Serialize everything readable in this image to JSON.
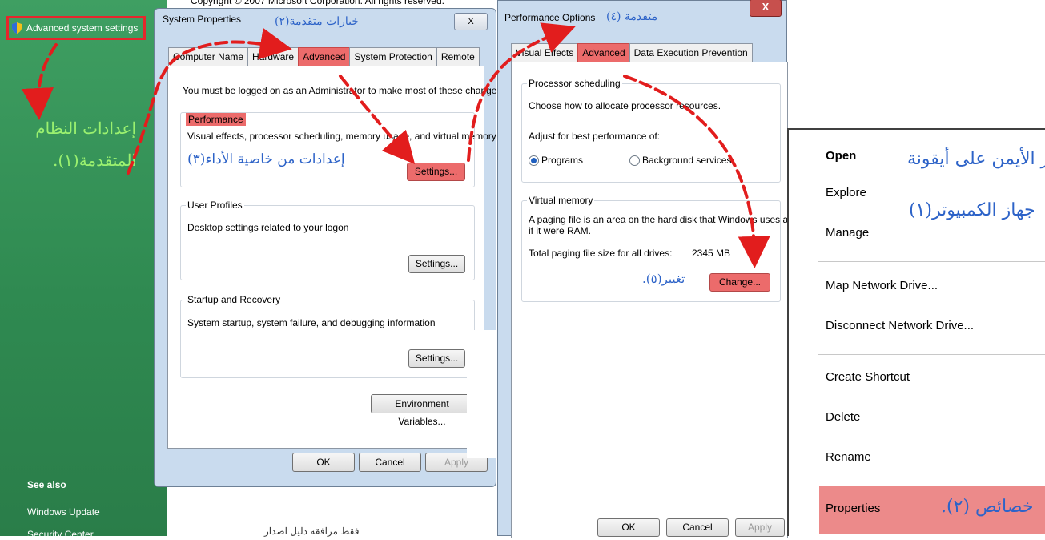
{
  "background": {
    "copyright": "Copyright © 2007 Microsoft Corporation. All rights reserved.",
    "bottom_text": "فقط مرافقه دليل اصدار"
  },
  "left_pane": {
    "advanced_link": "Advanced system settings",
    "annotation_step1": "إعدادات النظام المتقدمة(١).",
    "see_also": "See also",
    "windows_update": "Windows Update",
    "security_center": "Security Center"
  },
  "system_properties": {
    "title": "System Properties",
    "annotation_title": "خيارات متقدمة(٢)",
    "close_glyph": "X",
    "tabs": [
      {
        "label": "Computer Name",
        "active": false
      },
      {
        "label": "Hardware",
        "active": false
      },
      {
        "label": "Advanced",
        "active": true
      },
      {
        "label": "System Protection",
        "active": false
      },
      {
        "label": "Remote",
        "active": false
      }
    ],
    "admin_note": "You must be logged on as an Administrator to make most of these changes.",
    "performance": {
      "label": "Performance",
      "description": "Visual effects, processor scheduling, memory usage, and virtual memory",
      "annotation": "إعدادات من خاصية الأداء(٣)",
      "settings_button": "Settings..."
    },
    "user_profiles": {
      "label": "User Profiles",
      "description": "Desktop settings related to your logon",
      "settings_button": "Settings..."
    },
    "startup_recovery": {
      "label": "Startup and Recovery",
      "description": "System startup, system failure, and debugging information",
      "settings_button": "Settings..."
    },
    "env_button": "Environment Variables...",
    "ok": "OK",
    "cancel": "Cancel",
    "apply": "Apply"
  },
  "performance_options": {
    "title": "Performance Options",
    "annotation_title": "متقدمة (٤)",
    "close_glyph": "X",
    "tabs": [
      {
        "label": "Visual Effects",
        "active": false
      },
      {
        "label": "Advanced",
        "active": true
      },
      {
        "label": "Data Execution Prevention",
        "active": false
      }
    ],
    "processor_scheduling": {
      "label": "Processor scheduling",
      "description": "Choose how to allocate processor resources.",
      "adjust_label": "Adjust for best performance of:",
      "option_programs": "Programs",
      "option_background": "Background services",
      "selected": "Programs"
    },
    "virtual_memory": {
      "label": "Virtual memory",
      "description_line1": "A paging file is an area on the hard disk that Windows uses as",
      "description_line2": "if it were RAM.",
      "total_label": "Total paging file size for all drives:",
      "total_value": "2345 MB",
      "annotation": "تغيير(٥).",
      "change_button": "Change..."
    },
    "ok": "OK",
    "cancel": "Cancel",
    "apply": "Apply"
  },
  "context_menu": {
    "annotation_line1": "بالزر الأيمن على أيقونة",
    "annotation_line2": "جهاز الكمبيوتر(١)",
    "items": {
      "open": "Open",
      "explore": "Explore",
      "manage": "Manage",
      "map_drive": "Map Network Drive...",
      "disconnect_drive": "Disconnect Network Drive...",
      "create_shortcut": "Create Shortcut",
      "delete": "Delete",
      "rename": "Rename",
      "properties": "Properties"
    },
    "properties_annotation": "خصائص (٢)."
  },
  "colors": {
    "highlight_red": "#ec6b6b",
    "arrow_red": "#e21d1d",
    "annotation_blue": "#2d63c8",
    "annotation_green": "#9bf16f",
    "nav_green": "#2f8a51"
  }
}
